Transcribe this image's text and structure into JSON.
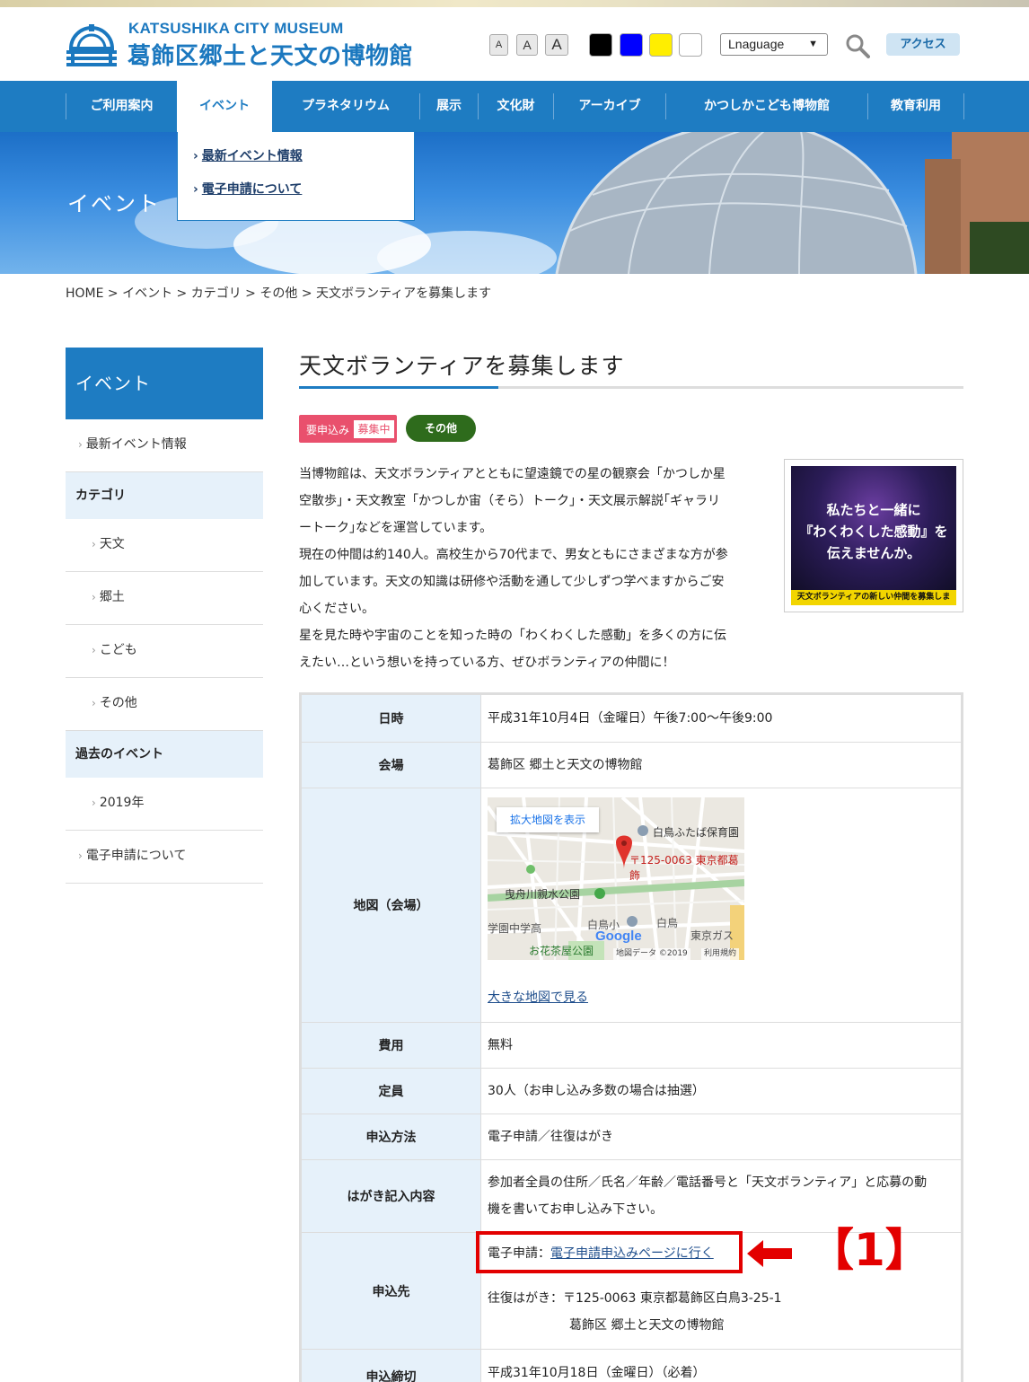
{
  "header": {
    "logo_en": "KATSUSHIKA CITY MUSEUM",
    "logo_ja": "葛飾区郷土と天文の博物館",
    "font_sizes": [
      "A",
      "A",
      "A"
    ],
    "colors": [
      "#000000",
      "#0000ff",
      "#ffee00",
      "#ffffff"
    ],
    "language_select": "Lnaguage",
    "access_label": "アクセス"
  },
  "nav": {
    "items": [
      "ご利用案内",
      "イベント",
      "プラネタリウム",
      "展示",
      "文化財",
      "アーカイブ",
      "かつしかこども博物館",
      "教育利用"
    ],
    "dropdown": [
      "最新イベント情報",
      "電子申請について"
    ]
  },
  "hero": {
    "title": "イベント"
  },
  "breadcrumb": "HOME > イベント > カテゴリ > その他 > 天文ボランティアを募集します",
  "sidebar": {
    "heading": "イベント",
    "latest": "最新イベント情報",
    "category_heading": "カテゴリ",
    "categories": [
      "天文",
      "郷土",
      "こども",
      "その他"
    ],
    "past_heading": "過去のイベント",
    "past_years": [
      "2019年"
    ],
    "eapp": "電子申請について"
  },
  "article": {
    "title": "天文ボランティアを募集します",
    "tag_required": "要申込み",
    "tag_status": "募集中",
    "tag_category": "その他",
    "intro": [
      "当博物館は、天文ボランティアとともに望遠鏡での星の観察会「かつしか星",
      "空散歩」・天文教室「かつしか宙（そら）トーク」・天文展示解説｢ギャラリ",
      "ートーク｣などを運営しています。",
      "現在の仲間は約140人。高校生から70代まで、男女ともにさまざまな方が参",
      "加しています。天文の知識は研修や活動を通して少しずつ学べますからご安",
      "心ください。",
      "星を見た時や宇宙のことを知った時の「わくわくした感動」を多くの方に伝",
      "えたい…という想いを持っている方、ぜひボランティアの仲間に！"
    ],
    "thumb_text1": "私たちと一緒に",
    "thumb_text2": "『わくわくした感動』を",
    "thumb_text3": "伝えませんか。",
    "thumb_strip": "天文ボランティアの新しい仲間を募集します。"
  },
  "table": {
    "datetime_label": "日時",
    "datetime": "平成31年10月4日（金曜日）午後7:00～午後9:00",
    "venue_label": "会場",
    "venue": "葛飾区 郷土と天文の博物館",
    "map_label": "地図（会場）",
    "map_expand": "拡大地図を表示",
    "map_address": "〒125-0063 東京都葛飾",
    "map_park": "曳舟川親水公園",
    "map_nursery": "白鳥ふたば保育園",
    "map_park2": "お花茶屋公園",
    "map_school": "学園中学高",
    "map_elem": "白鳥小",
    "map_shiratori": "白鳥",
    "map_gas": "東京ガス",
    "map_google": "Google",
    "map_copyright": "地図データ ©2019",
    "map_terms": "利用規約",
    "map_big": "大きな地図で見る",
    "fee_label": "費用",
    "fee": "無料",
    "capacity_label": "定員",
    "capacity": "30人（お申し込み多数の場合は抽選）",
    "method_label": "申込方法",
    "method": "電子申請／往復はがき",
    "postcard_label": "はがき記入内容",
    "postcard_1": "参加者全員の住所／氏名／年齢／電話番号と「天文ボランティア」と応募の動",
    "postcard_2": "機を書いてお申し込み下さい。",
    "apply_to_label": "申込先",
    "eapp_prefix": "電子申請：",
    "eapp_link": "電子申請申込みページに行く",
    "postcard_addr_1": "往復はがき：〒125-0063 東京都葛飾区白鳥3-25-1",
    "postcard_addr_2": "葛飾区 郷土と天文の博物館",
    "deadline_label": "申込締切",
    "deadline": "平成31年10月18日（金曜日）（必着）"
  },
  "annotation": {
    "label": "【1】",
    "color": "#e30000"
  }
}
